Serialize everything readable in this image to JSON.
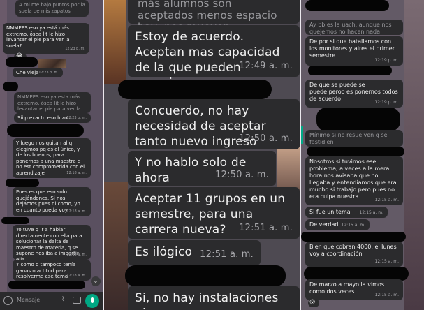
{
  "col1": {
    "m0": {
      "text": "A mi me bajo puntos por la suela de mis zapatos",
      "time": ""
    },
    "m1": {
      "text": "NMMEES eso ya está más extremo, ósea lit le hizo levantar el pie para ver la suela?",
      "time": "12:23 p. m."
    },
    "m1e": "😂",
    "m2": {
      "text": "Che vieja",
      "time": "12:23 p. m."
    },
    "m3": {
      "text": "NMMEES eso ya esta más extremo, ósea lit le hizo levantar el pie para ver la suela?",
      "time": ""
    },
    "m4": {
      "text": "Siiip exacto eso hizo",
      "time": "12:23 p. m."
    },
    "m5": {
      "text": "Y luego nos quitan al q elegimos pq es el único, y de los buenos, para ponernos a una maestra q no est comprometida con el aprendizaje",
      "time": "12:18 a. m."
    },
    "m6": {
      "text": "Pues es que eso solo quejándones. Si nos dejamos pues ni como, yo en cuanto pueda voy",
      "time": "12:18 a. m."
    },
    "m7": {
      "text": "Yo tuve q ir a hablar directamente con ella para solucionar la dalta de maestro de materia, q se supone nos iba a impartir ella",
      "time": "12:18 a. m."
    },
    "m8": {
      "text": "Y como q tampoco tenía ganas o actitud para resolverme ese tema",
      "time": "12:18 a. m."
    },
    "input_placeholder": "Mensaje",
    "scroll_icon": "chevron-down-icon"
  },
  "col2": {
    "m0": {
      "text": "más alumnos son aceptados menos espacio hay, nos mueven ...",
      "time": ""
    },
    "m1": {
      "text": "Estoy de acuerdo. Aceptan mas capacidad de la que pueden manejar",
      "time": "12:49 a. m."
    },
    "m2": {
      "text": "Concuerdo, no hay necesidad de aceptar tanto nuevo ingreso",
      "time": "12:50 a. m."
    },
    "m3": {
      "text": "Y no hablo solo de ahora",
      "time": "12:50 a. m."
    },
    "m4": {
      "text": "Aceptar 11 grupos en un semestre, para una carrera nueva?",
      "time": "12:51 a. m."
    },
    "m5": {
      "text": "Es ilógico",
      "time": "12:51 a. m."
    },
    "m6": {
      "text": "Si, no hay instalaciones ni",
      "time": ""
    }
  },
  "col3": {
    "m0": {
      "text": "Ay bb es la uach, aunque nos quejemos no hacen nada",
      "time": ""
    },
    "m1": {
      "text": "De por si que batallamos con los monitores y aires el primer semestre",
      "time": "12:19 p. m."
    },
    "m2": {
      "text": "De que se puede se puede,peroo es ponernos todos de acuerdo",
      "time": "12:19 p. m."
    },
    "m3": {
      "text": "Mínimo si no resuelven q se fastidien",
      "time": ""
    },
    "m4": {
      "text": "Nosotros si tuvimos ese problema, a veces a la mera hora nos avisaba que no llegaba y entendíamos que era mucho si trabajo pero pues no era culpa nuestra",
      "time": "12:15 a. m."
    },
    "m5": {
      "text": "Si fue un tema",
      "time": "12:15 a. m."
    },
    "m6": {
      "text": "De verdad",
      "time": "12:15 a. m."
    },
    "m7": {
      "text": "Bien que cobran 4000, el lunes voy a coordinación",
      "time": "12:15 a. m."
    },
    "m8": {
      "text": "De marzo a mayo la vimos como dos veces",
      "time": "12:15 a. m."
    },
    "m8e": "😮"
  }
}
